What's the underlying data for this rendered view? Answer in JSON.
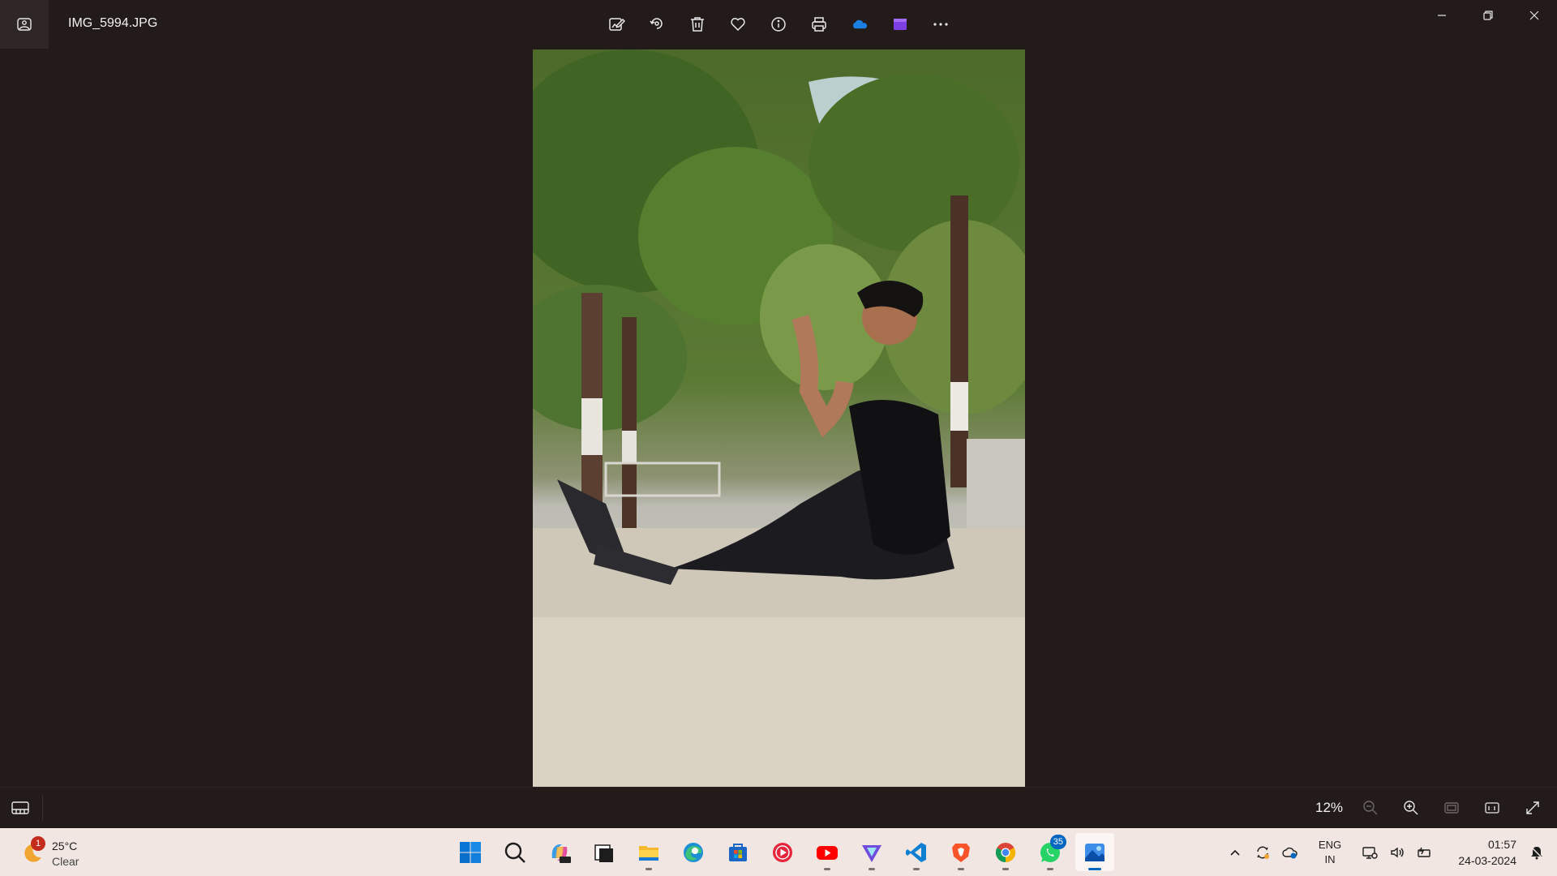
{
  "window": {
    "file_name": "IMG_5994.JPG"
  },
  "toolbar": {
    "buttons": [
      {
        "name": "edit-image-button",
        "icon": "edit-image-icon"
      },
      {
        "name": "rotate-button",
        "icon": "rotate-icon"
      },
      {
        "name": "delete-button",
        "icon": "trash-icon"
      },
      {
        "name": "favorite-button",
        "icon": "heart-icon"
      },
      {
        "name": "info-button",
        "icon": "info-icon"
      },
      {
        "name": "print-button",
        "icon": "printer-icon"
      },
      {
        "name": "onedrive-button",
        "icon": "onedrive-cloud-icon"
      },
      {
        "name": "clipchamp-button",
        "icon": "clipchamp-icon"
      },
      {
        "name": "more-options-button",
        "icon": "ellipsis-icon"
      }
    ]
  },
  "photo": {
    "subject": "man-sitting-outdoors-photo"
  },
  "bottombar": {
    "zoom_level": "12%"
  },
  "taskbar": {
    "weather": {
      "temperature": "25°C",
      "condition": "Clear",
      "badge_count": "1"
    },
    "apps": [
      {
        "name": "start-button",
        "icon": "windows-logo-icon"
      },
      {
        "name": "search-button",
        "icon": "search-icon"
      },
      {
        "name": "copilot-button",
        "icon": "copilot-icon"
      },
      {
        "name": "task-view-button",
        "icon": "task-view-icon"
      },
      {
        "name": "file-explorer-button",
        "icon": "folder-icon"
      },
      {
        "name": "edge-button",
        "icon": "edge-icon"
      },
      {
        "name": "store-button",
        "icon": "store-icon"
      },
      {
        "name": "media-player-button",
        "icon": "media-player-icon"
      },
      {
        "name": "youtube-button",
        "icon": "youtube-icon"
      },
      {
        "name": "vpn-button",
        "icon": "vpn-icon"
      },
      {
        "name": "vscode-button",
        "icon": "vscode-icon"
      },
      {
        "name": "brave-button",
        "icon": "brave-icon"
      },
      {
        "name": "chrome-button",
        "icon": "chrome-icon"
      },
      {
        "name": "whatsapp-button",
        "icon": "whatsapp-icon",
        "badge": "35"
      },
      {
        "name": "photos-button",
        "icon": "photos-icon"
      }
    ],
    "language_line1": "ENG",
    "language_line2": "IN",
    "time": "01:57",
    "date": "24-03-2024"
  },
  "colors": {
    "app_background": "#221b19",
    "taskbar_background": "#f1e6e2",
    "accent": "#0067c0"
  }
}
